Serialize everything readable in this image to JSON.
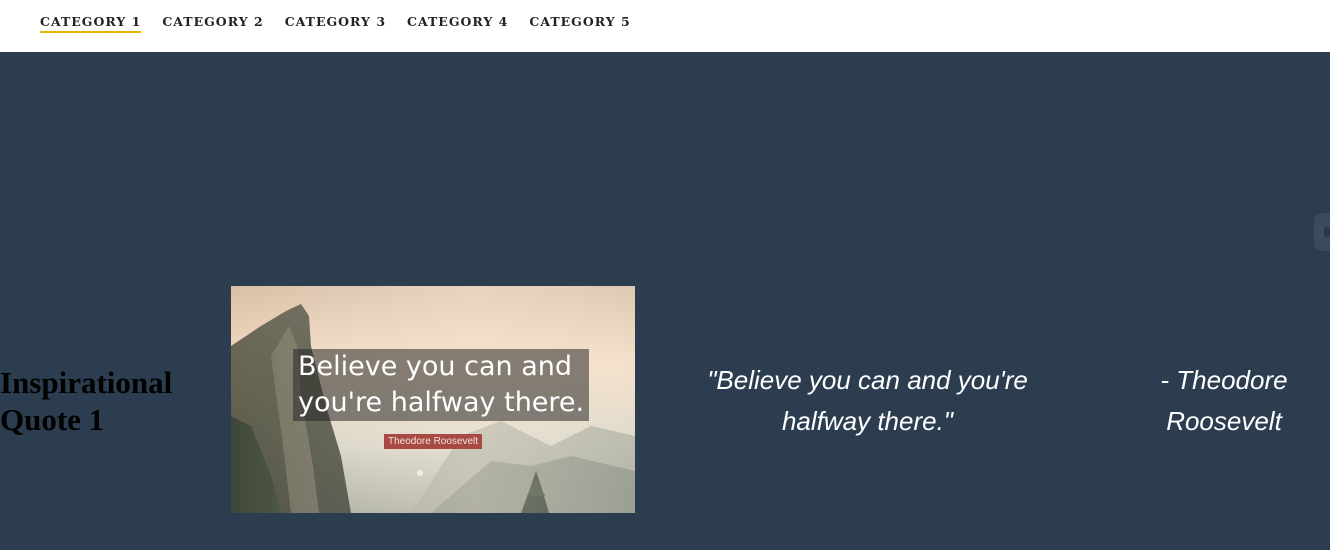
{
  "nav": {
    "items": [
      {
        "label": "CATEGORY 1",
        "active": true
      },
      {
        "label": "CATEGORY 2",
        "active": false
      },
      {
        "label": "CATEGORY 3",
        "active": false
      },
      {
        "label": "CATEGORY 4",
        "active": false
      },
      {
        "label": "CATEGORY 5",
        "active": false
      }
    ],
    "active_underline_color": "#e8b800"
  },
  "hero": {
    "background_color": "#2d3d50",
    "title": "Inspirational Quote 1",
    "image": {
      "quote_line_1": "Believe you can and",
      "quote_line_2": "you're halfway there.",
      "author_badge": "Theodore Roosevelt",
      "badge_color": "#a84a43"
    },
    "quote": "\"Believe you can and you're halfway there.\"",
    "author": "- Theodore Roosevelt"
  },
  "side_tab": {
    "icon": "chat-icon"
  }
}
